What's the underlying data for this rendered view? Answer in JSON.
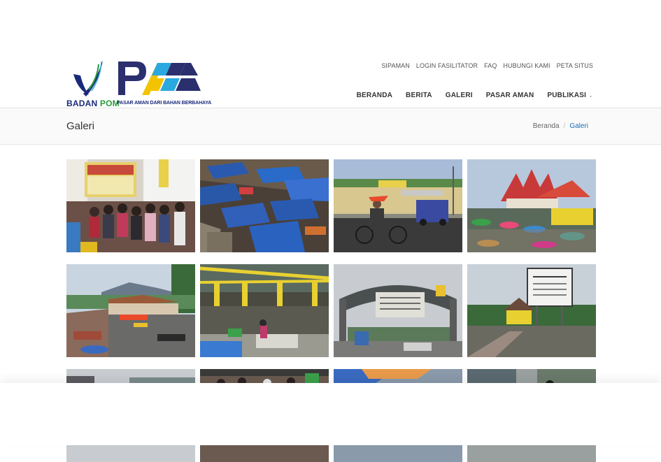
{
  "logo": {
    "badan_label": "BADAN",
    "pom_label": "POM",
    "pam_tagline": "PASAR AMAN DARI BAHAN BERBAHAYA"
  },
  "topnav": [
    "SIPAMAN",
    "LOGIN FASILITATOR",
    "FAQ",
    "HUBUNGI KAMI",
    "PETA SITUS"
  ],
  "mainnav": [
    "BERANDA",
    "BERITA",
    "GALERI",
    "PASAR AMAN",
    "PUBLIKASI"
  ],
  "page_title": "Galeri",
  "breadcrumb": {
    "home": "Beranda",
    "sep": "/",
    "current": "Galeri"
  },
  "gallery": {
    "photos": [
      {
        "name": "market-event-banner-photo"
      },
      {
        "name": "market-blue-tarps-photo"
      },
      {
        "name": "market-street-cyclist-photo"
      },
      {
        "name": "market-minangkabau-roof-photo"
      },
      {
        "name": "market-mountain-view-photo"
      },
      {
        "name": "market-yellow-hall-photo"
      },
      {
        "name": "pasar-induk-lambaro-gate-photo"
      },
      {
        "name": "pasar-signboard-photo"
      },
      {
        "name": "market-row3-photo-1"
      },
      {
        "name": "market-row3-photo-2"
      },
      {
        "name": "market-row3-photo-3"
      },
      {
        "name": "market-row3-photo-4"
      }
    ]
  },
  "colors": {
    "brand_navy": "#1a2a7a",
    "brand_green": "#2a9a3a",
    "pam_yellow": "#f2c400",
    "pam_blue": "#2aa8e0",
    "link_blue": "#1a6fb8"
  }
}
